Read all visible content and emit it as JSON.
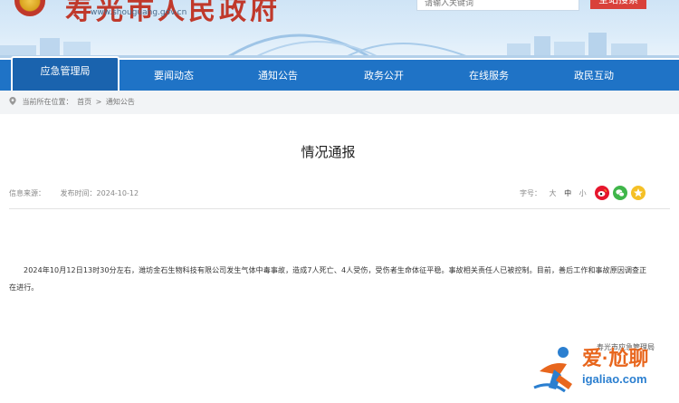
{
  "header": {
    "site_title": "寿光市人民政府",
    "site_url": "www.shouguang.gov.cn",
    "search_placeholder": "请输入关键词",
    "search_button": "全站搜索"
  },
  "nav": {
    "items": [
      {
        "label": "应急管理局",
        "active": true
      },
      {
        "label": "要闻动态",
        "active": false
      },
      {
        "label": "通知公告",
        "active": false
      },
      {
        "label": "政务公开",
        "active": false
      },
      {
        "label": "在线服务",
        "active": false
      },
      {
        "label": "政民互动",
        "active": false
      }
    ]
  },
  "breadcrumb": {
    "prefix": "当前所在位置：",
    "home": "首页",
    "sep": ">",
    "current": "通知公告"
  },
  "article": {
    "title": "情况通报",
    "source_label": "信息来源：",
    "date_label": "发布时间：",
    "date": "2024-10-12",
    "font_size_label": "字号：",
    "font_large": "大",
    "font_medium": "中",
    "font_small": "小",
    "body": "2024年10月12日13时30分左右，潍坊金石生物科技有限公司发生气体中毒事故，造成7人死亡、4人受伤，受伤者生命体征平稳。事故相关责任人已被控制。目前，善后工作和事故原因调查正在进行。",
    "source_note": "寿光市应急管理局"
  },
  "share_icons": [
    "weibo-icon",
    "wechat-icon",
    "qzone-icon"
  ],
  "watermark": {
    "main": "爱·尬聊",
    "url": "igaliao.com"
  },
  "colors": {
    "nav_blue": "#1f73c6",
    "accent_red": "#d9413a",
    "watermark_orange": "#e8661d",
    "watermark_blue": "#2b7fd0"
  }
}
